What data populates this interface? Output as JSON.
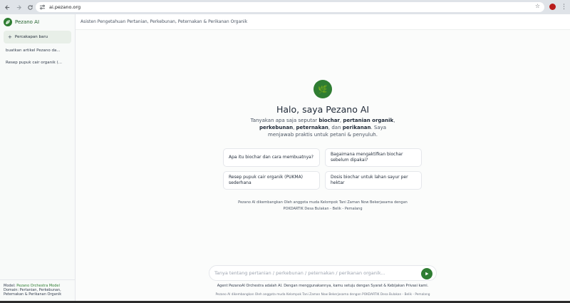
{
  "browser": {
    "url": "ai.pezano.org",
    "icons": [
      "back-icon",
      "forward-icon",
      "reload-icon",
      "site-settings-icon",
      "star-icon",
      "profile-avatar",
      "menu-kebab-icon"
    ]
  },
  "sidebar": {
    "brand": "Pezano AI",
    "new_chat_label": "Percakapan baru",
    "history": [
      {
        "label": "buatkan artikel Pezano da..."
      },
      {
        "label": "Resep pupuk cair organik (..."
      }
    ],
    "footer": {
      "model_prefix": "Model: ",
      "model_name": "Pezano Orchestra Model",
      "domain_line1": "Domain: Pertanian, Perkebunan,",
      "domain_line2": "Peternakan & Perikanan Organik"
    }
  },
  "topbar": {
    "title": "Asisten Pengetahuan Pertanian, Perkebunan, Peternakan & Perikanan Organik"
  },
  "hero": {
    "logo_emoji": "🌿",
    "title": "Halo, saya Pezano AI",
    "desc": {
      "t1": "Tanyakan apa saja seputar ",
      "b1": "biochar",
      "t2": ", ",
      "b2": "pertanian organik",
      "t3": ", ",
      "b3": "perkebunan",
      "t4": ", ",
      "b4": "peternakan",
      "t5": ", dan ",
      "b5": "perikanan",
      "t6": ". Saya menjawab praktis untuk petani & penyuluh."
    }
  },
  "suggestions": [
    {
      "label": "Apa itu biochar dan cara membuatnya?"
    },
    {
      "label": "Bagaimana mengaktifkan biochar sebelum dipakai?"
    },
    {
      "label": "Resep pupuk cair organik (PUKMA) sederhana"
    },
    {
      "label": "Dosis biochar untuk lahan sayur per hektar"
    }
  ],
  "credit": {
    "line1": "Pezano AI dikembangkan Oleh anggota muda Kelompok Tani Zaman Now Bekerjasama dengan",
    "line2": "POKDARTIK Desa Bulakan - Belik - Pemalang"
  },
  "composer": {
    "placeholder": "Tanya tentang pertanian / perkebunan / peternakan / perikanan organik...",
    "value": ""
  },
  "disclaimer": "Agent PezanoAI Orchestra adalah AI. Dengan menggunakannya, kamu setuju dengan Syarat & Kebijakan Privasi kami.",
  "footnote": "Pezano AI dikembangkan Oleh anggota muda Kelompok Tani Zaman Now Bekerjasama dengan POKDARTIK Desa Bulakan - Belik - Pemalang",
  "colors": {
    "accent": "#2f7d32",
    "sidebar_bg": "#f8faf9",
    "new_chat_bg": "#e8efe8"
  }
}
